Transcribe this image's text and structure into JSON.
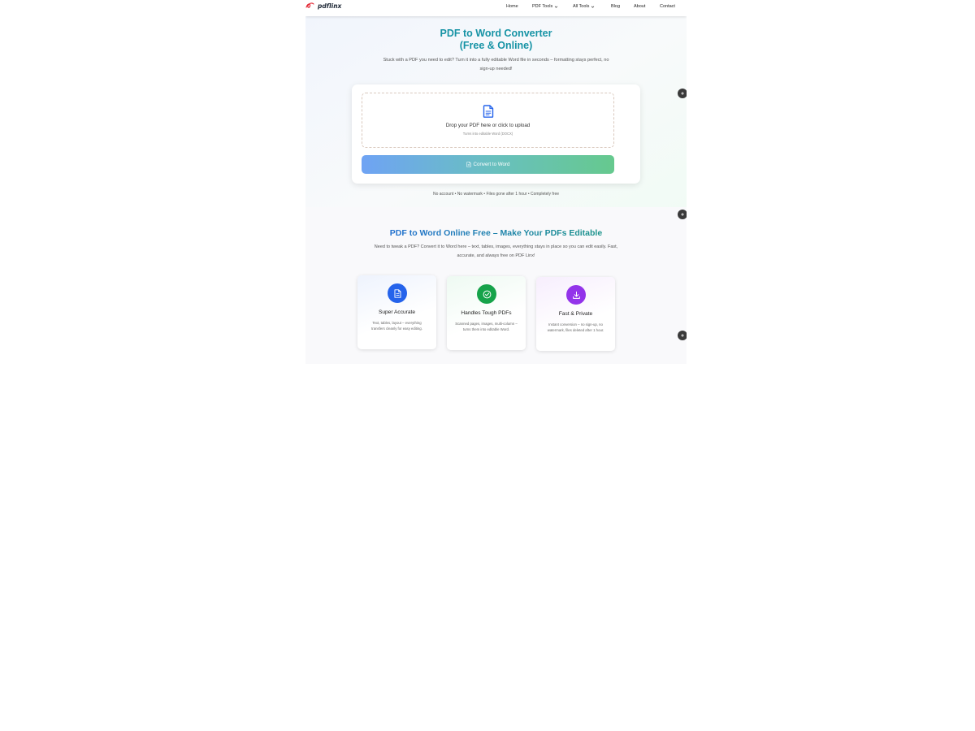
{
  "brand": {
    "name": "pdflinx",
    "accent": "#e11d2a"
  },
  "nav": {
    "items": [
      {
        "label": "Home",
        "has_dropdown": false
      },
      {
        "label": "PDF Tools",
        "has_dropdown": true
      },
      {
        "label": "All Tools",
        "has_dropdown": true
      },
      {
        "label": "Blog",
        "has_dropdown": false
      },
      {
        "label": "About",
        "has_dropdown": false
      },
      {
        "label": "Contact",
        "has_dropdown": false
      }
    ]
  },
  "hero": {
    "title_line1": "PDF to Word Converter",
    "title_line2": "(Free & Online)",
    "title_color": "#1693a5",
    "subtitle": "Stuck with a PDF you need to edit? Turn it into a fully editable Word file in seconds – formatting stays perfect, no sign-up needed!",
    "dropzone": {
      "icon": "document-icon",
      "title": "Drop your PDF here or click to upload",
      "subtitle": "Turns into editable Word (DOCX)"
    },
    "convert_button": {
      "icon": "document-icon",
      "label": "Convert to Word"
    },
    "footer_note": "No account • No watermark • Files gone after 1 hour • Completely free"
  },
  "features": {
    "title": "PDF to Word Online Free – Make Your PDFs Editable",
    "subtitle": "Need to tweak a PDF? Convert it to Word here – text, tables, images, everything stays in place so you can edit easily. Fast, accurate, and always free on PDF Linx!",
    "cards": [
      {
        "icon": "document-icon",
        "icon_color": "#2563eb",
        "title": "Super Accurate",
        "text": "Text, tables, layout – everything transfers cleanly for easy editing."
      },
      {
        "icon": "check-circle-icon",
        "icon_color": "#16a34a",
        "title": "Handles Tough PDFs",
        "text": "Scanned pages, images, multi-column – turns them into editable Word."
      },
      {
        "icon": "download-icon",
        "icon_color": "#9333ea",
        "title": "Fast & Private",
        "text": "Instant conversion – no sign-up, no watermark, files deleted after 1 hour."
      }
    ]
  },
  "side_buttons": [
    {
      "icon": "widget-icon"
    },
    {
      "icon": "widget-icon"
    },
    {
      "icon": "widget-icon"
    }
  ]
}
